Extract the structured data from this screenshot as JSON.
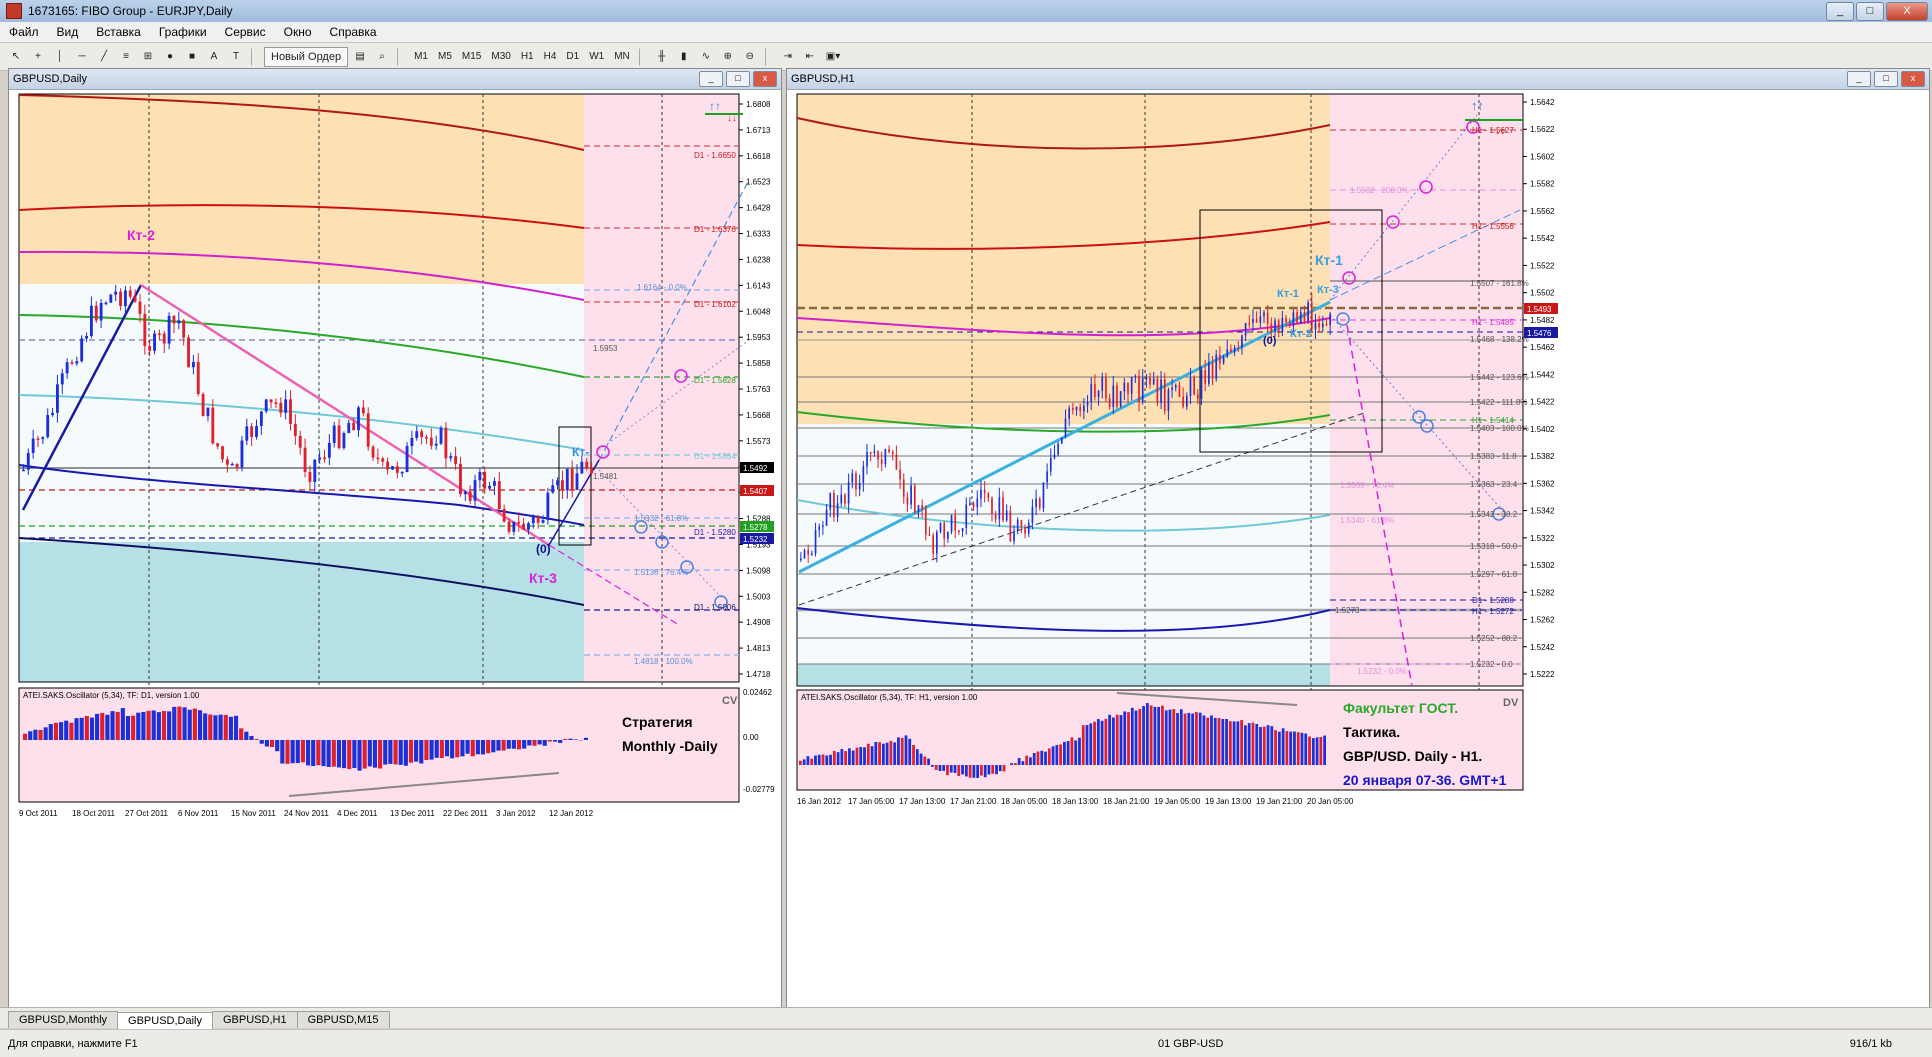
{
  "app": {
    "window_title": "1673165: FIBO Group - EURJPY,Daily",
    "window_buttons": {
      "minimize": "_",
      "maximize": "□",
      "close": "X"
    }
  },
  "menu": [
    "Файл",
    "Вид",
    "Вставка",
    "Графики",
    "Сервис",
    "Окно",
    "Справка"
  ],
  "toolbar": {
    "new_order_label": "Новый Ордер",
    "timeframes": [
      "M1",
      "M5",
      "M15",
      "M30",
      "H1",
      "H4",
      "D1",
      "W1",
      "MN"
    ],
    "cursor_tool_glyphs": [
      "↖",
      "+",
      "│",
      "─",
      "╱",
      "≡",
      "⊞",
      "●",
      "■",
      "A",
      "T"
    ]
  },
  "left_chart": {
    "title": "GBPUSD,Daily",
    "price_ticks": [
      "1.6808",
      "1.6713",
      "1.6618",
      "1.6523",
      "1.6428",
      "1.6333",
      "1.6238",
      "1.6143",
      "1.6048",
      "1.5953",
      "1.5858",
      "1.5763",
      "1.5668",
      "1.5573",
      "1.5478",
      "1.5383",
      "1.5288",
      "1.5193",
      "1.5098",
      "1.5003",
      "1.4908",
      "1.4813",
      "1.4718"
    ],
    "current_price": "1.5492",
    "red_price_tag": "1.5407",
    "green_price_tag": "1.5278",
    "blue_price_tag": "1.5232",
    "level_labels": {
      "d1_1": "D1 - 1.6650",
      "d1_2": "D1 - 1.6376",
      "d1_3": "D1 - 1.6102",
      "d1_4": "D1 - 1.5828",
      "d1_5": "D1 - 1.5554",
      "d1_6": "D1 - 1.5280",
      "d1_7": "D1 - 1.5006",
      "fib_0": "1.6164 - 0.0%",
      "fib_1": "1.5953",
      "fib_2": "1.5481",
      "fib_618": "1.5332 - 61.8%",
      "fib_764": "1.5136 - 76.4%",
      "fib_100": "1.4818 - 100.0%"
    },
    "annotations": {
      "kt2": "Кт-2",
      "kt3": "Кт-3",
      "kt1": "Кт-",
      "zero": "(0)"
    },
    "x_labels": [
      "9 Oct 2011",
      "18 Oct 2011",
      "27 Oct 2011",
      "6 Nov 2011",
      "15 Nov 2011",
      "24 Nov 2011",
      "4 Dec 2011",
      "13 Dec 2011",
      "22 Dec 2011",
      "3 Jan 2012",
      "12 Jan 2012"
    ],
    "osc_title": "ATEI.SAKS.Oscillator (5,34), TF: D1, version 1.00",
    "osc_corner": "CV",
    "osc_high": "0.02462",
    "osc_zero": "0.00",
    "osc_low": "-0.02779",
    "strategy_text1": "Стратегия",
    "strategy_text2": "Monthly -Daily"
  },
  "right_chart": {
    "title": "GBPUSD,H1",
    "price_ticks": [
      "1.5642",
      "1.5622",
      "1.5602",
      "1.5582",
      "1.5562",
      "1.5542",
      "1.5522",
      "1.5502",
      "1.5482",
      "1.5462",
      "1.5442",
      "1.5422",
      "1.5402",
      "1.5382",
      "1.5362",
      "1.5342",
      "1.5322",
      "1.5302",
      "1.5282",
      "1.5262",
      "1.5242",
      "1.5222"
    ],
    "current_price": "1.5493",
    "blue_price_tag": "1.5476",
    "level_labels": {
      "h1_1": "H1 - 1.5627",
      "f200": "1.5582 - 200.0%",
      "h1_2": "H1 - 1.5556",
      "l1507": "1.5507 - 161.8%",
      "h1_3": "H1 - 1.5485",
      "l1468": "1.5468 - 138.2%",
      "l1442": "1.5442 - 123.6%",
      "l1422": "1.5422 - 111.8%",
      "h1_4": "H1 - 1.5414",
      "l1403": "1.5403 - 100.0%",
      "l1383": "1.5383 - 11.8",
      "l1363": "1.5363 - 23.4",
      "l1342": "1.5342 - 38.2",
      "l1318": "1.5318 - 50.0",
      "l1297": "1.5297 - 61.8",
      "d1_1": "D1 - 1.5280",
      "l1273": "1.5273",
      "h1_5": "H1 - 1.5272",
      "l1252": "1.5252 - 88.2",
      "l1232": "1.5232 - 0.0",
      "f_mid1": "1.5369 - 76.4%",
      "f_mid2": "1.5340 - 61.8%",
      "f_low0": "1.5232 - 0.0%"
    },
    "annotations": {
      "kt1_big": "Кт-1",
      "kt1_small": "Кт-1",
      "kt3": "Кт-3",
      "kt2": "Кт-2",
      "zero": "(0)"
    },
    "x_labels": [
      "16 Jan 2012",
      "17 Jan 05:00",
      "17 Jan 13:00",
      "17 Jan 21:00",
      "18 Jan 05:00",
      "18 Jan 13:00",
      "18 Jan 21:00",
      "19 Jan 05:00",
      "19 Jan 13:00",
      "19 Jan 21:00",
      "20 Jan 05:00"
    ],
    "osc_title": "ATEI.SAKS.Oscillator (5,34), TF: H1, version 1.00",
    "osc_corner": "DV",
    "text_faculty": "Факультет ГОСТ.",
    "text_tactic": "Тактика.",
    "text_pair": "GBP/USD. Daily - H1.",
    "text_date": "20 января 07-36. GMT+1"
  },
  "tabs": [
    "GBPUSD,Monthly",
    "GBPUSD,Daily",
    "GBPUSD,H1",
    "GBPUSD,M15"
  ],
  "active_tab": "GBPUSD,Daily",
  "status": {
    "help": "Для справки, нажмите F1",
    "profile": "01 GBP-USD",
    "traffic": "916/1 kb"
  },
  "colors": {
    "orange_zone": "#fde0b4",
    "cyan_zone": "#b5e1e6",
    "pink_zone": "#fde0ec",
    "bull_candle": "#1c2fd8",
    "bear_candle": "#e0202a",
    "accent_green": "#2fa82f",
    "accent_magenta": "#dd20dd"
  }
}
